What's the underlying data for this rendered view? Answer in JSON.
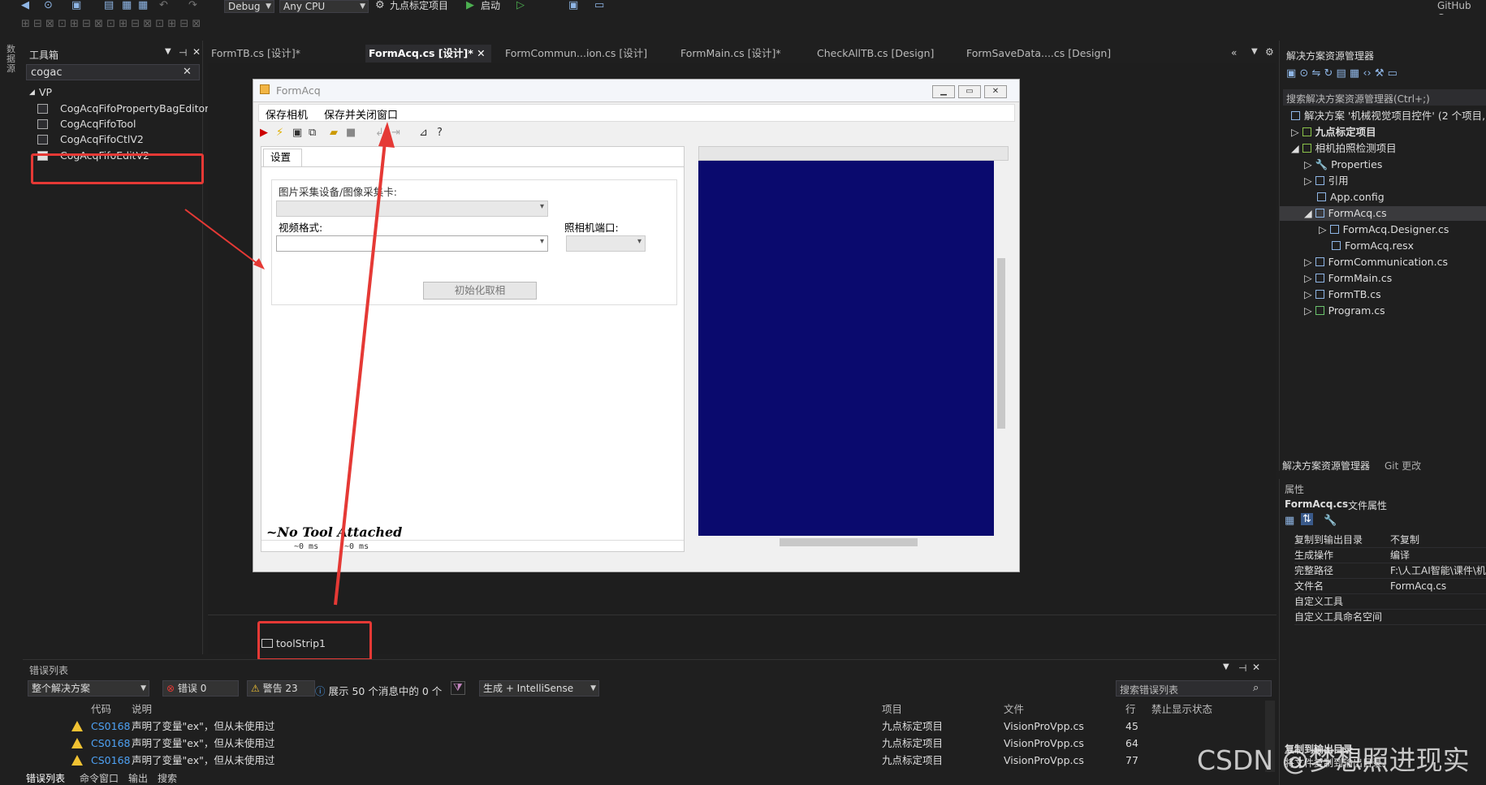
{
  "toolbar": {
    "config": "Debug",
    "platform": "Any CPU",
    "startup_project": "九点标定项目",
    "start_label": "启动",
    "github": "GitHub Co"
  },
  "rail": {
    "label": "数据源"
  },
  "toolbox": {
    "title": "工具箱",
    "search_value": "cogac",
    "group": "VP",
    "items": [
      {
        "label": "CogAcqFifoPropertyBagEditorCtl"
      },
      {
        "label": "CogAcqFifoTool"
      },
      {
        "label": "CogAcqFifoCtlV2"
      },
      {
        "label": "CogAcqFifoEditV2"
      }
    ]
  },
  "tabs": [
    {
      "label": "FormTB.cs [设计]*"
    },
    {
      "label": "FormAcq.cs [设计]*"
    },
    {
      "label": "FormCommun...ion.cs [设计]"
    },
    {
      "label": "FormMain.cs [设计]*"
    },
    {
      "label": "CheckAllTB.cs [Design]"
    },
    {
      "label": "FormSaveData....cs [Design]"
    }
  ],
  "form": {
    "title": "FormAcq",
    "menu": [
      "保存相机",
      "保存并关闭窗口"
    ],
    "settings_tab": "设置",
    "device_label": "图片采集设备/图像采集卡:",
    "video_format_label": "视频格式:",
    "camera_port_label": "照相机端口:",
    "init_button": "初始化取相",
    "no_tool": "~No Tool Attached",
    "status": [
      "~0 ms",
      "~0 ms"
    ]
  },
  "tray": {
    "item": "toolStrip1"
  },
  "solution_explorer": {
    "title": "解决方案资源管理器",
    "search_placeholder": "搜索解决方案资源管理器(Ctrl+;)",
    "solution": "解决方案 '机械视觉项目控件' (2 个项目,",
    "items": [
      {
        "label": "九点标定项目"
      },
      {
        "label": "相机拍照检测项目"
      },
      {
        "label": "Properties"
      },
      {
        "label": "引用"
      },
      {
        "label": "App.config"
      },
      {
        "label": "FormAcq.cs"
      },
      {
        "label": "FormAcq.Designer.cs"
      },
      {
        "label": "FormAcq.resx"
      },
      {
        "label": "FormCommunication.cs"
      },
      {
        "label": "FormMain.cs"
      },
      {
        "label": "FormTB.cs"
      },
      {
        "label": "Program.cs"
      }
    ],
    "bottom_tabs": [
      "解决方案资源管理器",
      "Git 更改"
    ]
  },
  "properties": {
    "title": "属性",
    "object": "FormAcq.cs",
    "object_type": "文件属性",
    "rows": [
      {
        "name": "复制到输出目录",
        "value": "不复制"
      },
      {
        "name": "生成操作",
        "value": "编译"
      },
      {
        "name": "完整路径",
        "value": "F:\\人工AI智能\\课件\\机"
      },
      {
        "name": "文件名",
        "value": "FormAcq.cs"
      },
      {
        "name": "自定义工具",
        "value": ""
      },
      {
        "name": "自定义工具命名空间",
        "value": ""
      }
    ],
    "desc_title": "复制到输出目录",
    "desc_text": "将文件复制到输出目录。"
  },
  "error_list": {
    "title": "错误列表",
    "scope": "整个解决方案",
    "errors": "错误 0",
    "warnings": "警告 23",
    "messages": "展示 50 个消息中的 0 个",
    "build_filter": "生成 + IntelliSense",
    "search_placeholder": "搜索错误列表",
    "columns": [
      "代码",
      "说明",
      "项目",
      "文件",
      "行",
      "禁止显示状态"
    ],
    "rows": [
      {
        "code": "CS0168",
        "desc": "声明了变量\"ex\"，但从未使用过",
        "project": "九点标定项目",
        "file": "VisionProVpp.cs",
        "line": "45"
      },
      {
        "code": "CS0168",
        "desc": "声明了变量\"ex\"，但从未使用过",
        "project": "九点标定项目",
        "file": "VisionProVpp.cs",
        "line": "64"
      },
      {
        "code": "CS0168",
        "desc": "声明了变量\"ex\"，但从未使用过",
        "project": "九点标定项目",
        "file": "VisionProVpp.cs",
        "line": "77"
      }
    ]
  },
  "bottom_tabs": [
    "错误列表",
    "命令窗口",
    "输出",
    "搜索"
  ],
  "watermark": "CSDN @梦想照进现实"
}
